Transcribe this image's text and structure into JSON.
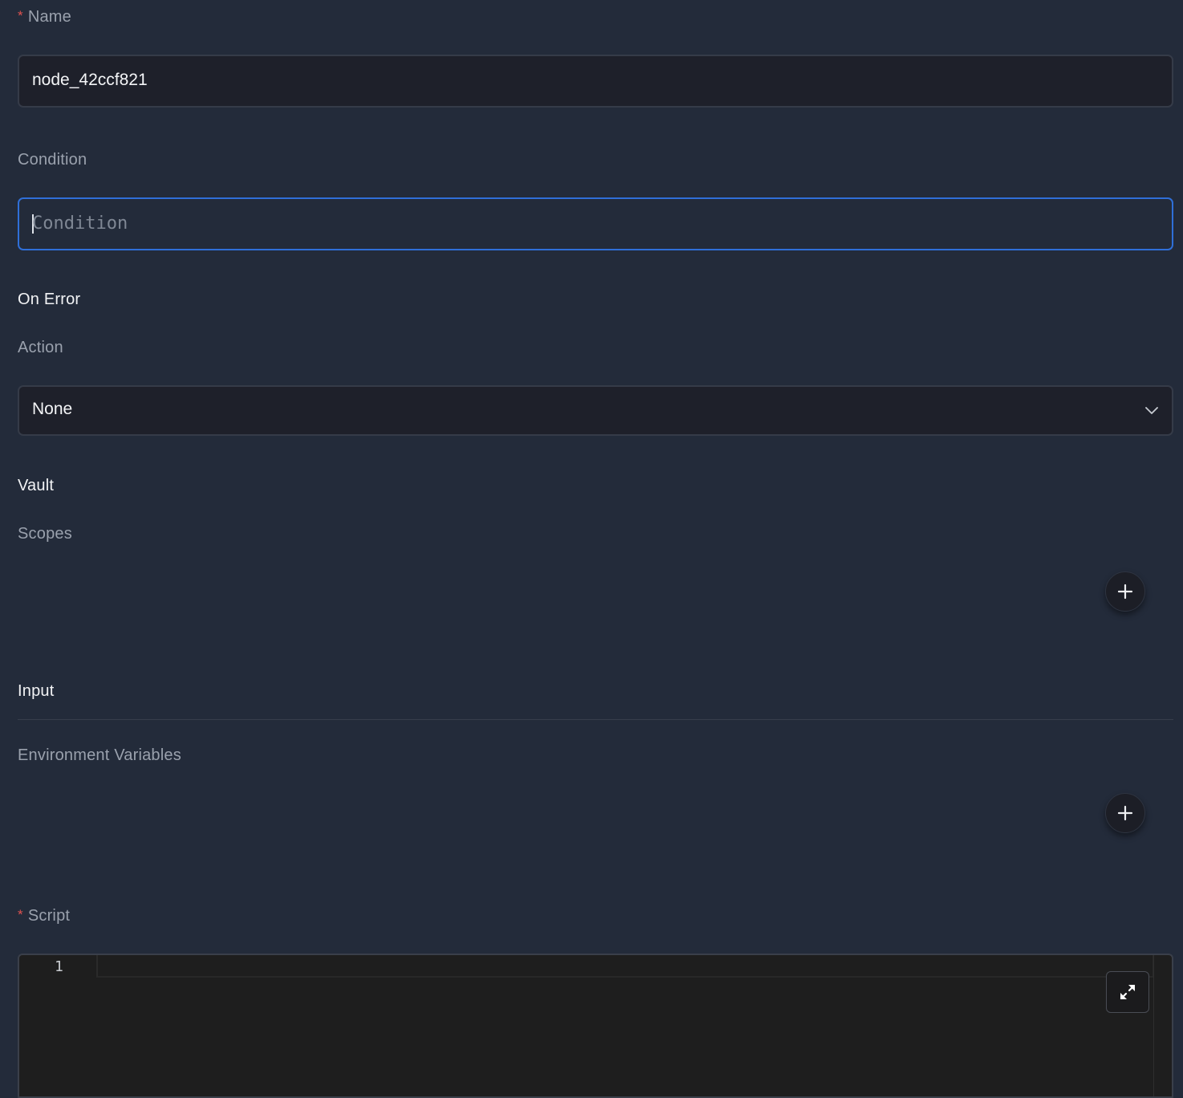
{
  "name_field": {
    "label": "Name",
    "required_mark": "*",
    "value": "node_42ccf821"
  },
  "condition_field": {
    "label": "Condition",
    "placeholder": "Condition",
    "value": ""
  },
  "on_error": {
    "title": "On Error",
    "action_label": "Action",
    "action_value": "None"
  },
  "vault": {
    "title": "Vault",
    "scopes_label": "Scopes"
  },
  "input": {
    "title": "Input",
    "env_label": "Environment Variables"
  },
  "script": {
    "label": "Script",
    "required_mark": "*",
    "line_numbers": [
      "1"
    ]
  },
  "icons": {
    "add_scope": "plus-icon",
    "add_env": "plus-icon",
    "action_dropdown": "chevron-down-icon",
    "expand_editor": "expand-icon"
  },
  "colors": {
    "background": "#232b3a",
    "input_background": "#1e202a",
    "focus_border": "#2f6fd8",
    "required": "#e0524f",
    "editor_background": "#1e1e1e"
  }
}
